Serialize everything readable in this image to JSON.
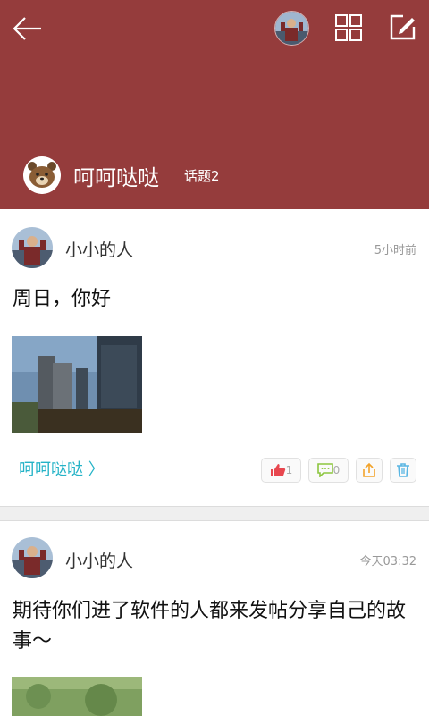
{
  "header": {
    "group_name": "呵呵哒哒",
    "topic_count": "话题2",
    "icons": [
      "back-arrow-icon",
      "user-avatar",
      "grid-icon",
      "edit-icon"
    ]
  },
  "posts": [
    {
      "username": "小小的人",
      "time": "5小时前",
      "text": "周日，你好",
      "tag": "呵呵哒哒 〉",
      "likes": "1",
      "comments": "0"
    },
    {
      "username": "小小的人",
      "time": "今天03:32",
      "text": "期待你们进了软件的人都来发帖分享自己的故事～"
    }
  ],
  "colors": {
    "header_bg": "#953c3c",
    "tag": "#25b3c7",
    "like": "#e8474f",
    "comment": "#8cc63f",
    "share": "#f2a32b",
    "delete": "#5ab6e3"
  }
}
